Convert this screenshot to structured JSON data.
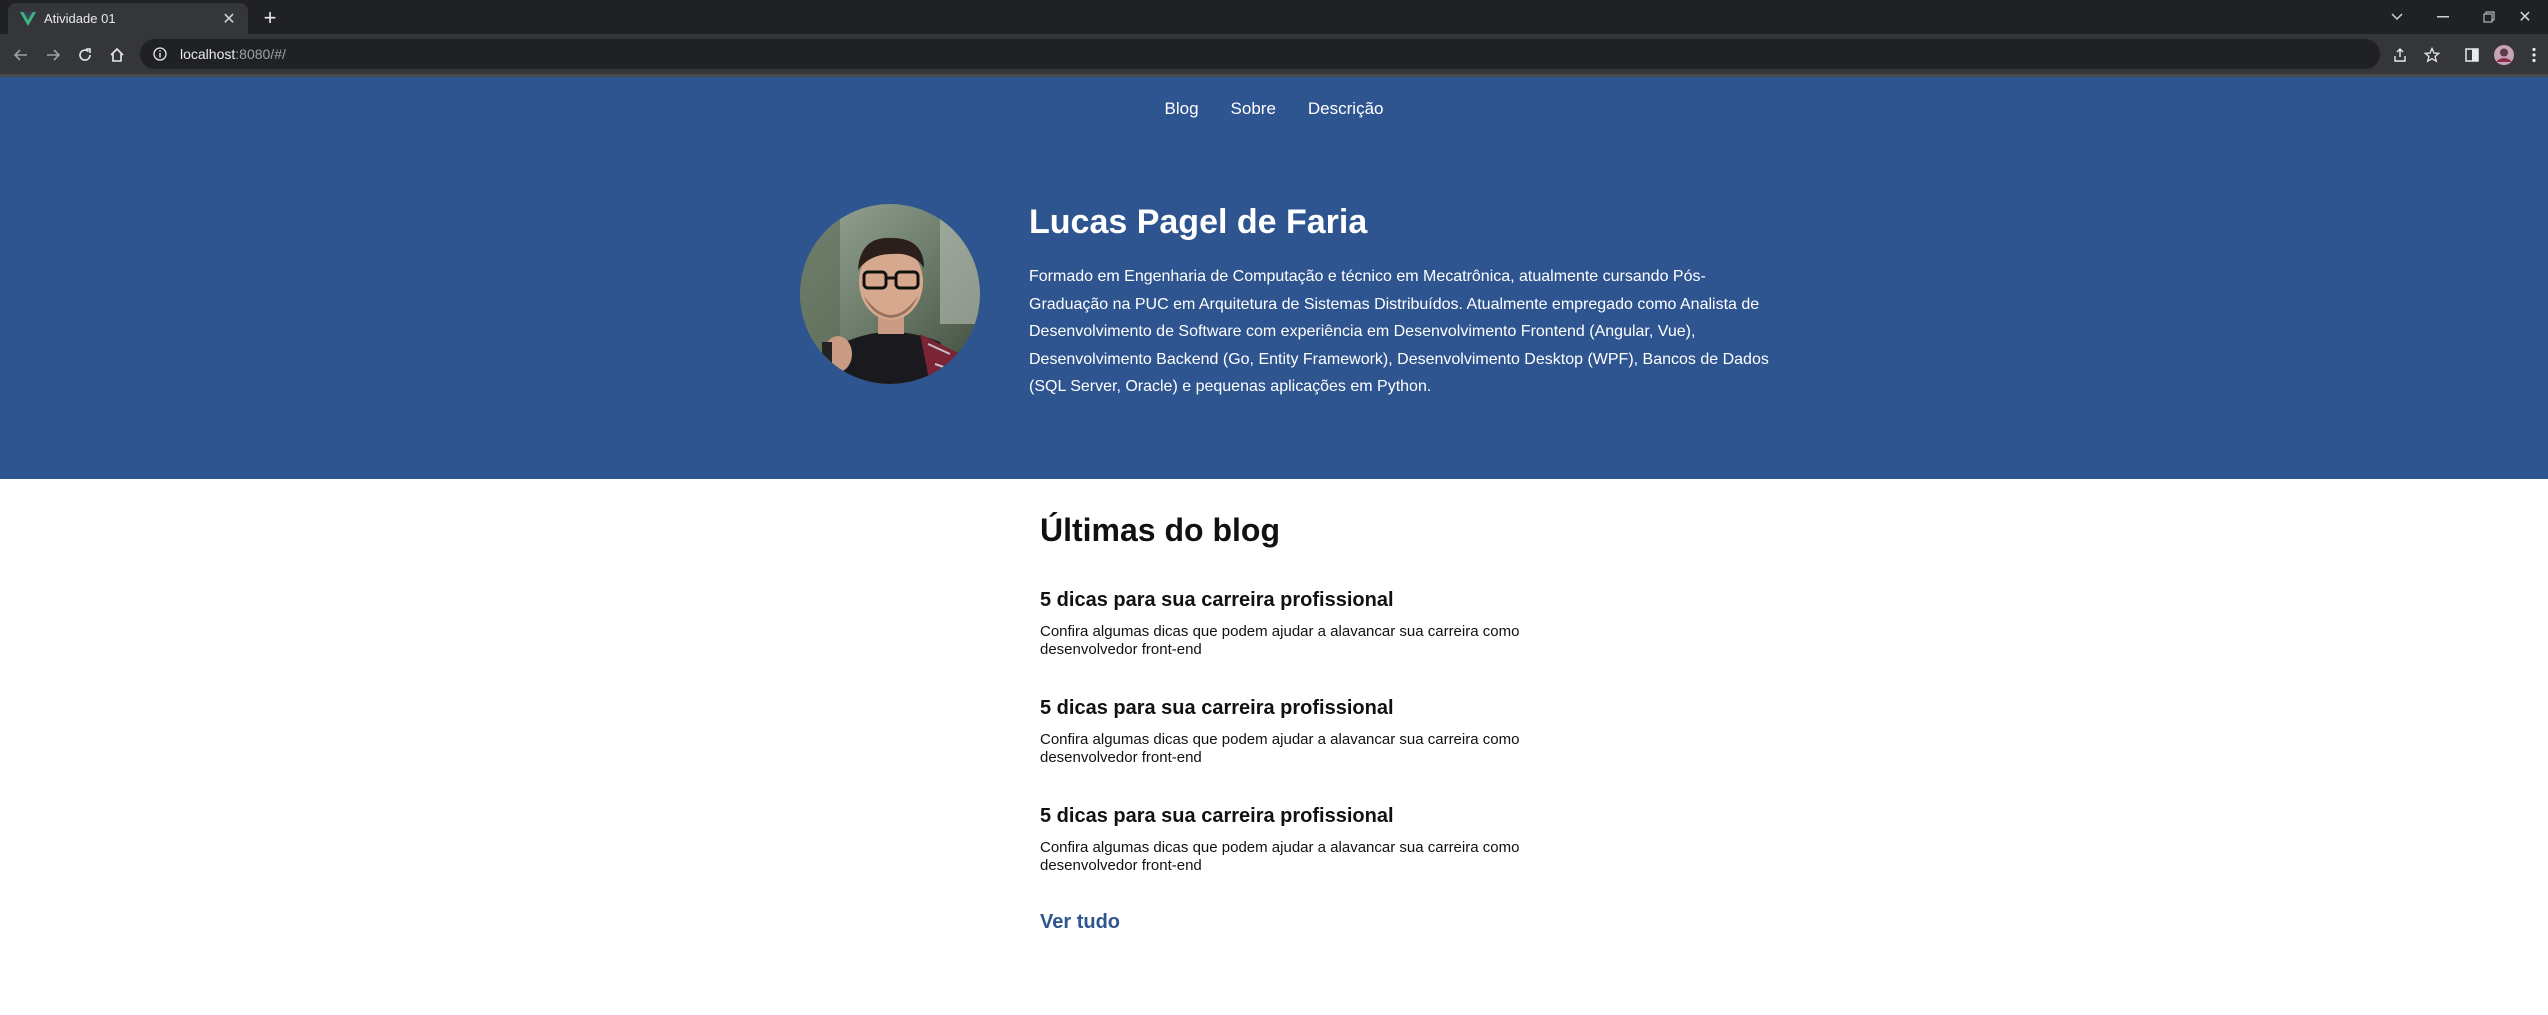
{
  "browser": {
    "tab_title": "Atividade 01",
    "url_host": "localhost",
    "url_rest": ":8080/#/"
  },
  "nav": {
    "items": [
      {
        "label": "Blog"
      },
      {
        "label": "Sobre"
      },
      {
        "label": "Descrição"
      }
    ]
  },
  "profile": {
    "name": "Lucas Pagel de Faria",
    "bio": "Formado em Engenharia de Computação e técnico em Mecatrônica, atualmente cursando Pós-Graduação na PUC em Arquitetura de Sistemas Distribuídos. Atualmente empregado como Analista de Desenvolvimento de Software com experiência em Desenvolvimento Frontend (Angular, Vue), Desenvolvimento Backend (Go, Entity Framework), Desenvolvimento Desktop (WPF), Bancos de Dados (SQL Server, Oracle) e pequenas aplicações em Python."
  },
  "blog": {
    "heading": "Últimas do blog",
    "posts": [
      {
        "title": "5 dicas para sua carreira profissional",
        "excerpt": "Confira algumas dicas que podem ajudar a alavancar sua carreira como desenvolvedor front-end"
      },
      {
        "title": "5 dicas para sua carreira profissional",
        "excerpt": "Confira algumas dicas que podem ajudar a alavancar sua carreira como desenvolvedor front-end"
      },
      {
        "title": "5 dicas para sua carreira profissional",
        "excerpt": "Confira algumas dicas que podem ajudar a alavancar sua carreira como desenvolvedor front-end"
      }
    ],
    "see_all_label": "Ver tudo"
  },
  "colors": {
    "hero_bg": "#2e5590",
    "link": "#2e5590",
    "vue_green": "#41b883"
  },
  "icons": [
    "vue-favicon-icon",
    "close-icon",
    "plus-icon",
    "chevron-down-icon",
    "minimize-icon",
    "restore-icon",
    "window-close-icon",
    "back-icon",
    "forward-icon",
    "reload-icon",
    "home-icon",
    "info-icon",
    "share-icon",
    "star-icon",
    "side-panel-icon",
    "profile-avatar-icon",
    "kebab-menu-icon"
  ]
}
